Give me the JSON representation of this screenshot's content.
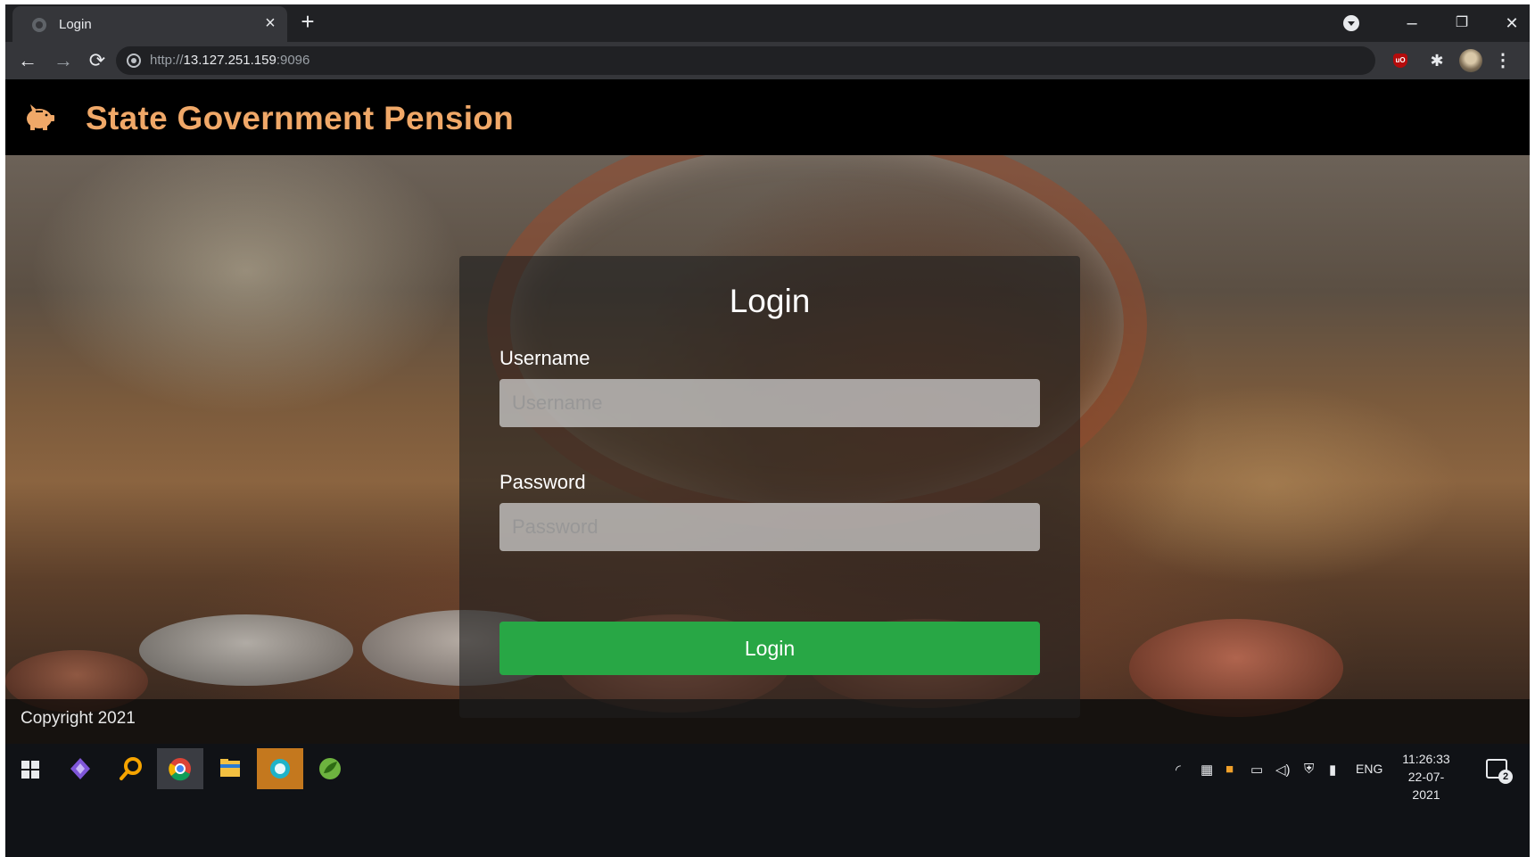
{
  "browser": {
    "tab_title": "Login",
    "tab_close": "×",
    "new_tab": "+",
    "url_scheme": "http://",
    "url_host": "13.127.251.159",
    "url_port": ":9096",
    "window_controls": {
      "minimize": "–",
      "restore": "❐",
      "close": "✕"
    },
    "nav": {
      "back": "←",
      "forward": "→",
      "reload": "⟳"
    },
    "extensions": {
      "ublock_label": "uO",
      "puzzle": "✱",
      "menu": "⋮"
    }
  },
  "page": {
    "brand": {
      "title": "State Government Pension",
      "icon": "piggy-bank-icon",
      "color": "#f0a868"
    },
    "login": {
      "heading": "Login",
      "username_label": "Username",
      "username_placeholder": "Username",
      "username_value": "",
      "password_label": "Password",
      "password_placeholder": "Password",
      "password_value": "",
      "submit_label": "Login",
      "submit_color": "#28a745"
    },
    "footer": {
      "copyright": "Copyright 2021"
    }
  },
  "taskbar": {
    "apps": [
      "windows-start-icon",
      "visual-studio-icon",
      "search-icon",
      "chrome-icon",
      "file-explorer-icon",
      "app-icon",
      "spring-tool-icon"
    ],
    "tray": {
      "language": "ENG"
    },
    "clock": {
      "time": "11:26:33",
      "date": "22-07-2021"
    },
    "notifications_count": "2"
  }
}
